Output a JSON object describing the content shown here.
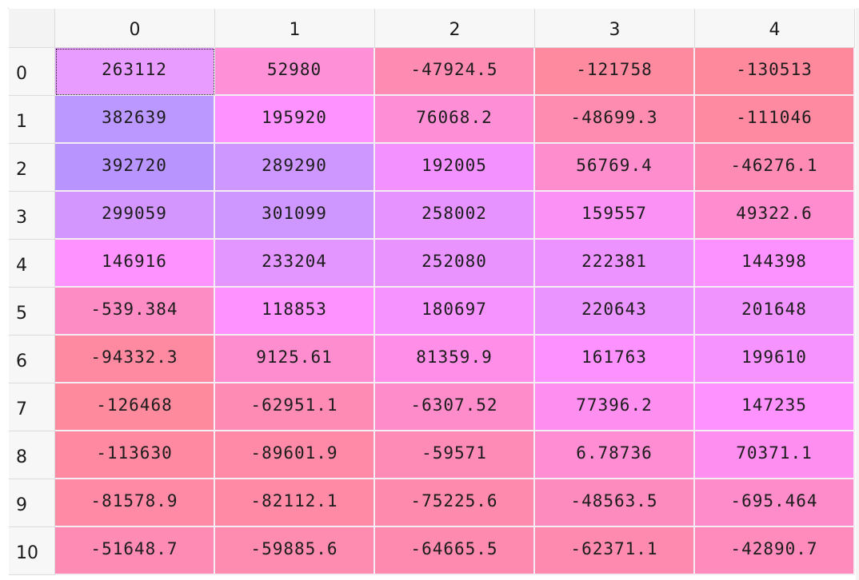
{
  "table": {
    "columns": [
      "0",
      "1",
      "2",
      "3",
      "4"
    ],
    "rows": [
      "0",
      "1",
      "2",
      "3",
      "4",
      "5",
      "6",
      "7",
      "8",
      "9",
      "10"
    ],
    "selected_cell": [
      0,
      0
    ],
    "cells": [
      [
        "263112",
        "52980",
        "-47924.5",
        "-121758",
        "-130513"
      ],
      [
        "382639",
        "195920",
        "76068.2",
        "-48699.3",
        "-111046"
      ],
      [
        "392720",
        "289290",
        "192005",
        "56769.4",
        "-46276.1"
      ],
      [
        "299059",
        "301099",
        "258002",
        "159557",
        "49322.6"
      ],
      [
        "146916",
        "233204",
        "252080",
        "222381",
        "144398"
      ],
      [
        "-539.384",
        "118853",
        "180697",
        "220643",
        "201648"
      ],
      [
        "-94332.3",
        "9125.61",
        "81359.9",
        "161763",
        "199610"
      ],
      [
        "-126468",
        "-62951.1",
        "-6307.52",
        "77396.2",
        "147235"
      ],
      [
        "-113630",
        "-89601.9",
        "-59571",
        "6.78736",
        "70371.1"
      ],
      [
        "-81578.9",
        "-82112.1",
        "-75225.6",
        "-48563.5",
        "-695.464"
      ],
      [
        "-51648.7",
        "-59885.6",
        "-64665.5",
        "-62371.1",
        "-42890.7"
      ]
    ],
    "colors": [
      [
        "#e99cff",
        "#fd90d7",
        "#fe8cb2",
        "#fe8aa0",
        "#fe899d"
      ],
      [
        "#bb98ff",
        "#fe93ff",
        "#fe8ed5",
        "#fe8bb0",
        "#fe8aa2"
      ],
      [
        "#b894ff",
        "#ce97ff",
        "#f291ff",
        "#fd8dcd",
        "#fe8bb4"
      ],
      [
        "#d396ff",
        "#ce97ff",
        "#e693ff",
        "#fc91f5",
        "#fe8cce"
      ],
      [
        "#fe93ff",
        "#e396ff",
        "#e993ff",
        "#ec93ff",
        "#fb92ff"
      ],
      [
        "#fe8cc4",
        "#fe93ff",
        "#f693ff",
        "#ea94ff",
        "#f193ff"
      ],
      [
        "#fe8aa2",
        "#fe8dcf",
        "#fe8ee7",
        "#fd91ff",
        "#f793ff"
      ],
      [
        "#fe8a9d",
        "#fe8bb4",
        "#fe8cca",
        "#fe8ff0",
        "#fe92ff"
      ],
      [
        "#fe89a0",
        "#fe8aa8",
        "#fe8bb5",
        "#fe8dd4",
        "#fe8eef"
      ],
      [
        "#fe8aa6",
        "#fe8aa6",
        "#fe8aad",
        "#fe8bbd",
        "#fe8ccb"
      ],
      [
        "#fe8bb4",
        "#fe8bb0",
        "#fe8aaf",
        "#fe8ab0",
        "#fe8bbb"
      ]
    ]
  }
}
